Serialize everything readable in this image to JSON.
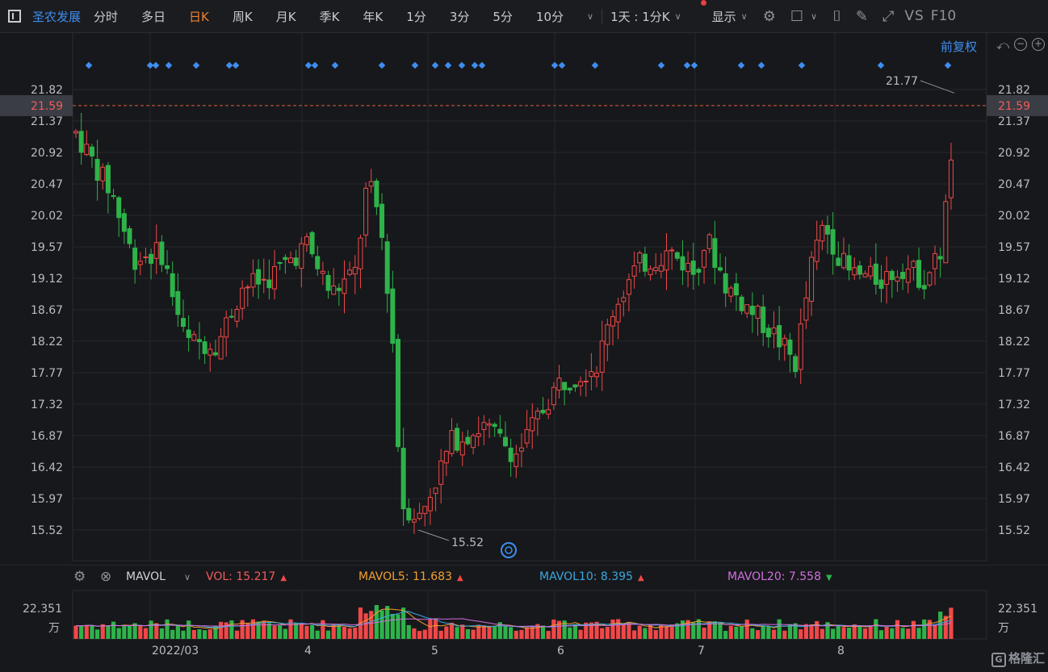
{
  "toolbar": {
    "stock_name": "圣农发展",
    "periods": [
      "分时",
      "多日",
      "日K",
      "周K",
      "月K",
      "季K",
      "年K",
      "1分",
      "3分",
      "5分",
      "10分"
    ],
    "active_period": "日K",
    "interval_label": "1天 : 1分K",
    "display_label": "显示",
    "vs_label": "VS",
    "f10_label": "F10"
  },
  "chart": {
    "adjust_label": "前复权",
    "price_ticks": [
      "21.82",
      "21.37",
      "20.92",
      "20.47",
      "20.02",
      "19.57",
      "19.12",
      "18.67",
      "18.22",
      "17.77",
      "17.32",
      "16.87",
      "16.42",
      "15.97",
      "15.52"
    ],
    "current_price": "21.59",
    "high_label": "21.77",
    "low_label": "15.52",
    "x_labels": [
      "2022/03",
      "4",
      "5",
      "6",
      "7",
      "8"
    ],
    "colors": {
      "up": "#f04848",
      "down": "#2eb34a",
      "signal": "#3d8ef0",
      "mavol5": "#f0a030",
      "mavol10": "#3aa8e0",
      "mavol20": "#d070e0"
    }
  },
  "indicator": {
    "name": "MAVOL",
    "vol_label": "VOL:",
    "vol_value": "15.217",
    "mavol5_label": "MAVOL5:",
    "mavol5_value": "11.683",
    "mavol10_label": "MAVOL10:",
    "mavol10_value": "8.395",
    "mavol20_label": "MAVOL20:",
    "mavol20_value": "7.558",
    "vol_axis_max": "22.351",
    "vol_unit": "万"
  },
  "badge": {
    "text": "格隆汇"
  }
}
